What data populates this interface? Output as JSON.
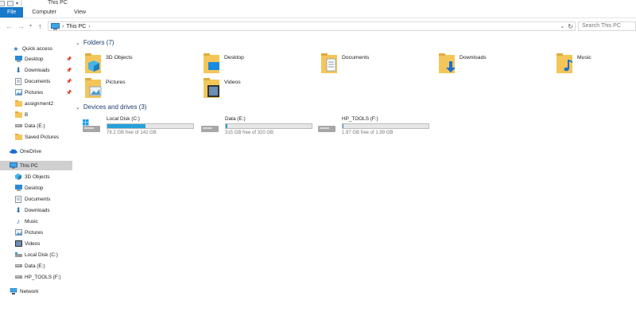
{
  "window": {
    "title": "This PC"
  },
  "ribbon": {
    "tabs": [
      {
        "label": "File"
      },
      {
        "label": "Computer"
      },
      {
        "label": "View"
      }
    ]
  },
  "address": {
    "path": "This PC",
    "separator": "›",
    "search_placeholder": "Search This PC"
  },
  "nav": {
    "quick_access": "Quick access",
    "quick_items": [
      "Desktop",
      "Downloads",
      "Documents",
      "Pictures",
      "assignment2",
      "B",
      "Data (E:)",
      "Saved Pictures"
    ],
    "onedrive": "OneDrive",
    "this_pc": "This PC",
    "pc_items": [
      "3D Objects",
      "Desktop",
      "Documents",
      "Downloads",
      "Music",
      "Pictures",
      "Videos",
      "Local Disk (C:)",
      "Data (E:)",
      "HP_TOOLS (F:)"
    ],
    "network": "Network"
  },
  "folders": {
    "header": "Folders (7)",
    "items": [
      "3D Objects",
      "Desktop",
      "Documents",
      "Downloads",
      "Music",
      "Pictures",
      "Videos"
    ]
  },
  "drives": {
    "header": "Devices and drives (3)",
    "items": [
      {
        "name": "Local Disk (C:)",
        "free": "79.2 GB free of 142 GB",
        "used_fraction": 0.44
      },
      {
        "name": "Data (E:)",
        "free": "315 GB free of 320 GB",
        "used_fraction": 0.02
      },
      {
        "name": "HP_TOOLS (F:)",
        "free": "1.97 GB free of 1.99 GB",
        "used_fraction": 0.01
      }
    ]
  },
  "colors": {
    "accent": "#1979ca",
    "drive_fill": "#26a0da",
    "folder": "#f4c65a",
    "selection": "#cfcfcf"
  }
}
